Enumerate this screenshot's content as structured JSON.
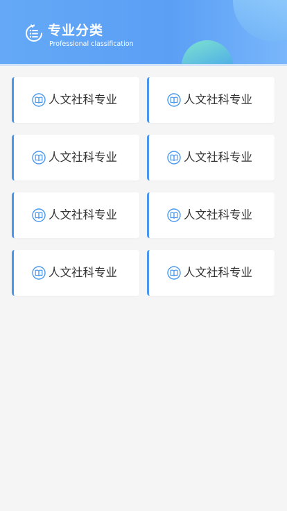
{
  "header": {
    "title": "专业分类",
    "subtitle": "Professional classification",
    "icon": "list-icon",
    "gradient_start": "#64a8f7",
    "gradient_end": "#79b6fb"
  },
  "categories": {
    "card_icon": "book-icon",
    "accent_color": "#4a98ee",
    "items": [
      {
        "label": "人文社科专业"
      },
      {
        "label": "人文社科专业"
      },
      {
        "label": "人文社科专业"
      },
      {
        "label": "人文社科专业"
      },
      {
        "label": "人文社科专业"
      },
      {
        "label": "人文社科专业"
      },
      {
        "label": "人文社科专业"
      },
      {
        "label": "人文社科专业"
      }
    ]
  }
}
